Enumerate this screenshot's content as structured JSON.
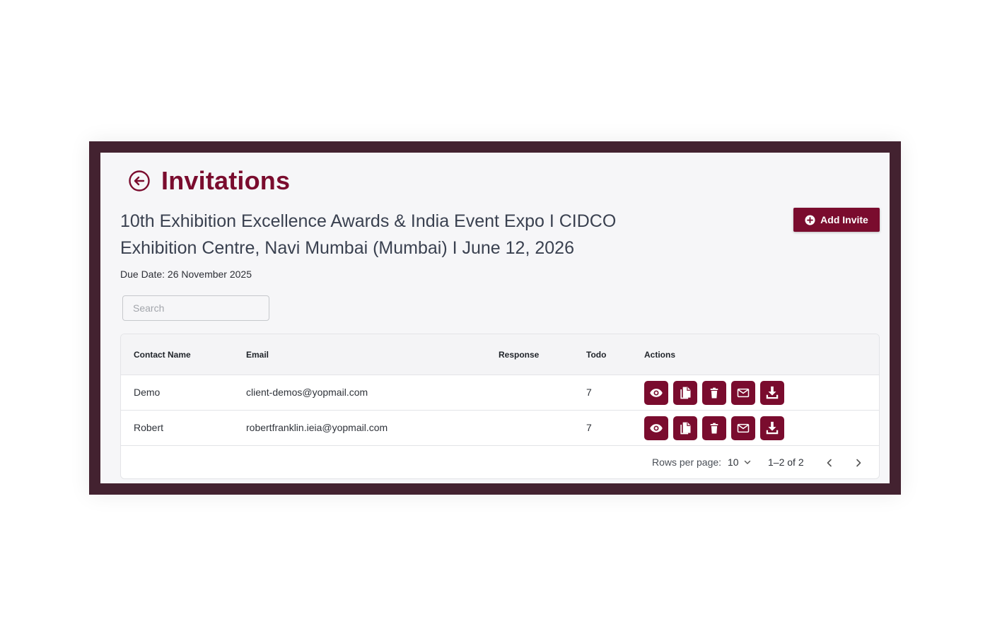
{
  "header": {
    "title": "Invitations",
    "back_icon": "arrow-left-circle-icon"
  },
  "event": {
    "title": "10th Exhibition Excellence Awards & India Event Expo I CIDCO Exhibition Centre, Navi Mumbai (Mumbai) I June 12, 2026",
    "due_date": "Due Date: 26 November 2025"
  },
  "toolbar": {
    "add_invite_label": "Add Invite",
    "add_icon": "plus-circle-icon"
  },
  "search": {
    "placeholder": "Search",
    "value": ""
  },
  "table": {
    "columns": [
      "Contact Name",
      "Email",
      "Response",
      "Todo",
      "Actions"
    ],
    "rows": [
      {
        "contact_name": "Demo",
        "email": "client-demos@yopmail.com",
        "response": "",
        "todo": "7"
      },
      {
        "contact_name": "Robert",
        "email": "robertfranklin.ieia@yopmail.com",
        "response": "",
        "todo": "7"
      }
    ],
    "action_icons": [
      "eye-icon",
      "copy-icon",
      "trash-icon",
      "mail-icon",
      "download-icon"
    ]
  },
  "pagination": {
    "rows_per_page_label": "Rows per page:",
    "rows_per_page_value": "10",
    "range": "1–2 of 2"
  },
  "colors": {
    "accent": "#7a0c2e",
    "frame": "#432230",
    "panel_bg": "#f6f6f8"
  }
}
